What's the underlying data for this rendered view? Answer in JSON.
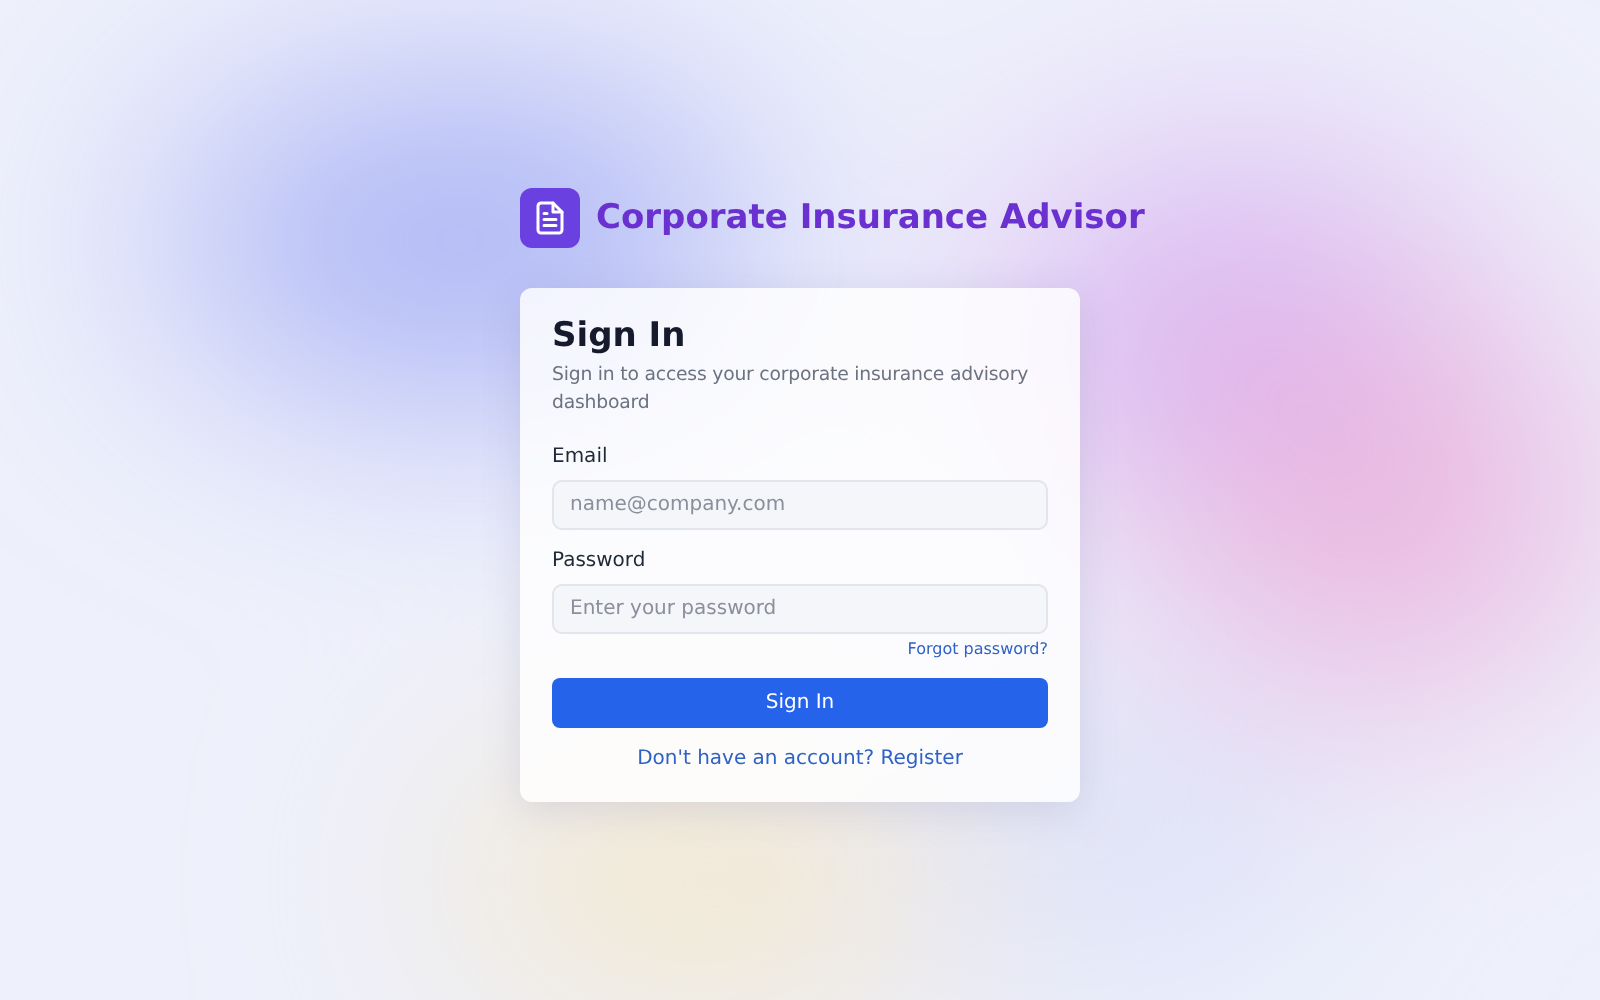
{
  "app": {
    "title": "Corporate Insurance Advisor"
  },
  "card": {
    "title": "Sign In",
    "subtitle": "Sign in to access your corporate insurance advisory dashboard"
  },
  "fields": [
    {
      "label": "Email",
      "placeholder": "name@company.com"
    },
    {
      "label": "Password",
      "placeholder": "Enter your password"
    }
  ],
  "forgot_link": "Forgot password?",
  "submit_button": "Sign In",
  "register_link": "Don't have an account? Register"
}
